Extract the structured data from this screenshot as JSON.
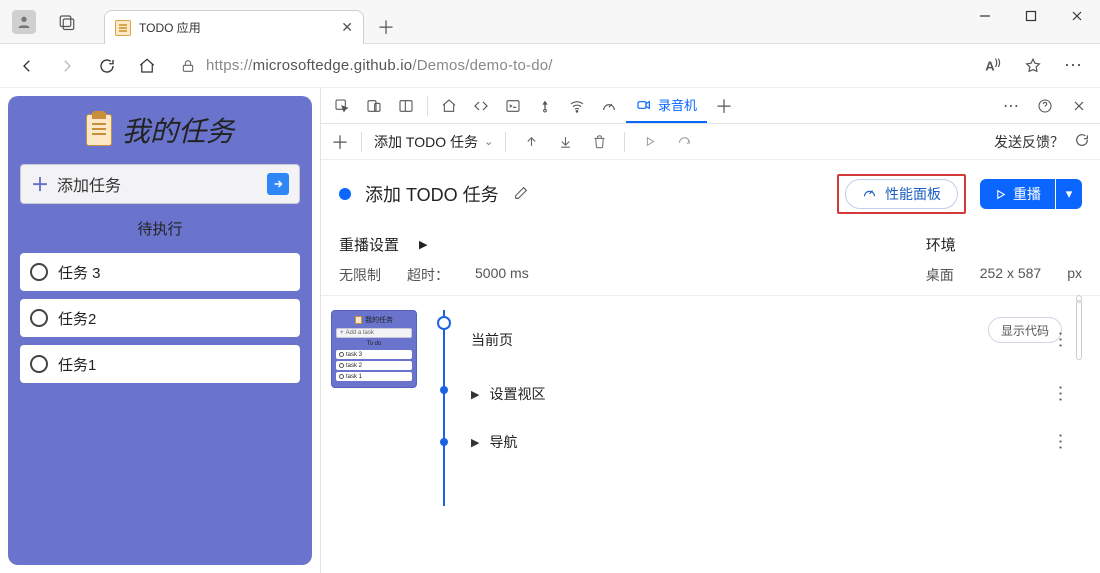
{
  "browser": {
    "tab_title": "TODO 应用",
    "url_scheme": "https://",
    "url_host": "microsoftedge.github.io",
    "url_path": "/Demos/demo-to-do/"
  },
  "app": {
    "title": "我的任务",
    "add_task_label": "添加任务",
    "section_label": "待执行",
    "tasks": [
      "任务 3",
      "任务2",
      "任务1"
    ]
  },
  "devtools": {
    "recorder_tab": "录音机",
    "toolbar_dropdown": "添加 TODO 任务",
    "feedback": "发送反馈？",
    "recording_title": "添加 TODO 任务",
    "perf_button": "性能面板",
    "replay_button": "重播",
    "settings": {
      "replay_label": "重播设置",
      "unlimited": "无限制",
      "timeout_label": "超时：",
      "timeout_value": "5000 ms",
      "env_label": "环境",
      "env_value_a": "桌面",
      "env_value_b": "252 x 587",
      "env_value_c": "px"
    },
    "show_code": "显示代码",
    "thumb": {
      "title": "我的任务",
      "add": "Add a task",
      "section": "To do",
      "tasks": [
        "task 3",
        "task 2",
        "task 1"
      ]
    },
    "steps": [
      "当前页",
      "设置视区",
      "导航"
    ]
  }
}
